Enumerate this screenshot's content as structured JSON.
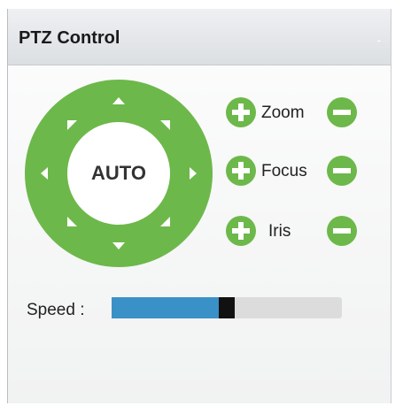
{
  "panel": {
    "title": "PTZ Control",
    "collapse_icon": "collapse-icon"
  },
  "pad": {
    "center_label": "AUTO",
    "arrow_icons": [
      "arrow-up-icon",
      "arrow-down-icon",
      "arrow-left-icon",
      "arrow-right-icon",
      "arrow-up-left-icon",
      "arrow-up-right-icon",
      "arrow-down-left-icon",
      "arrow-down-right-icon"
    ]
  },
  "controls": [
    {
      "label": "Zoom"
    },
    {
      "label": "Focus"
    },
    {
      "label": "Iris"
    }
  ],
  "speed": {
    "label": "Speed :",
    "value_fraction": 0.5
  },
  "colors": {
    "accent_green": "#6db84a",
    "slider_blue": "#3a91c8",
    "knob": "#111111"
  }
}
